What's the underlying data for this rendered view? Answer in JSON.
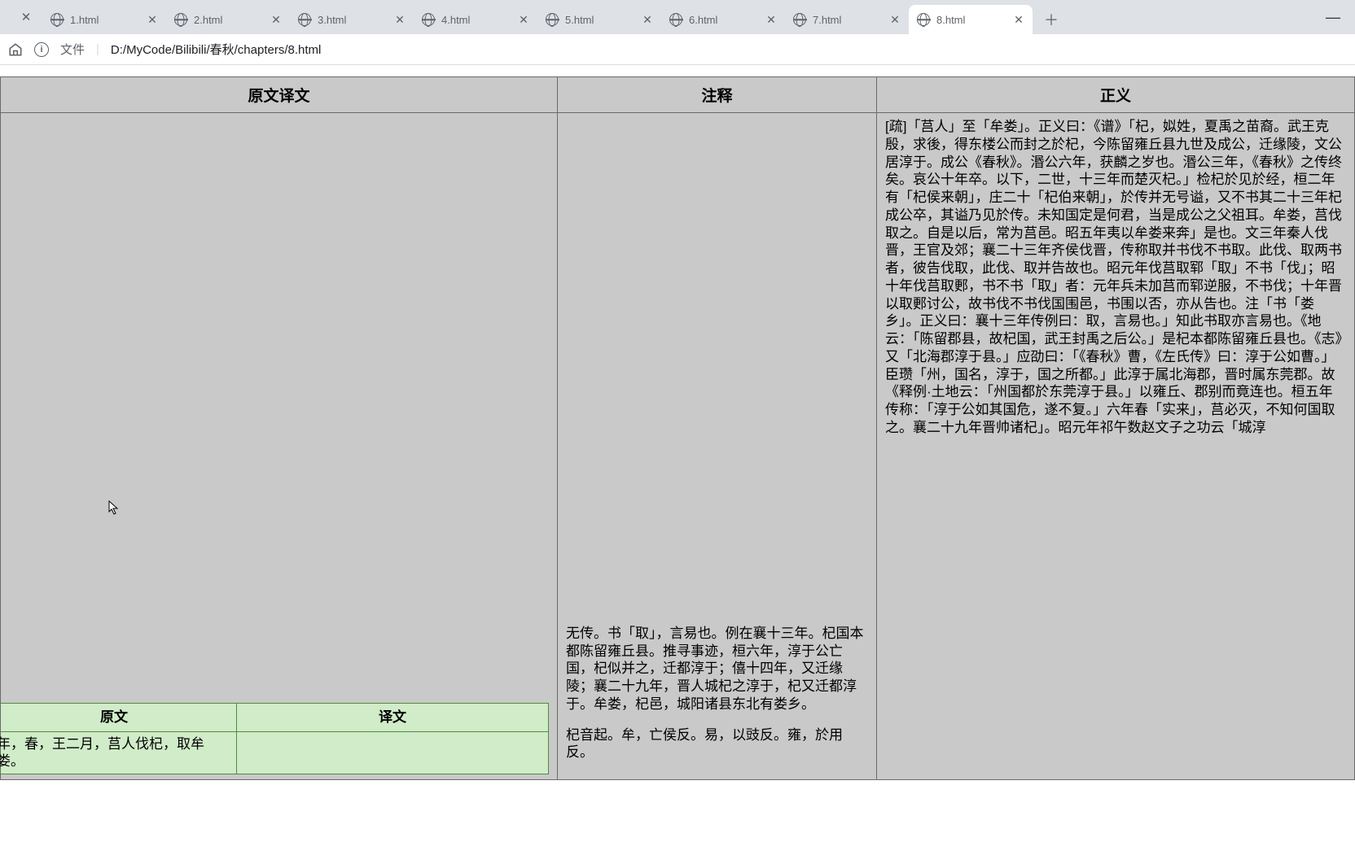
{
  "tabs": [
    {
      "label": "1.html"
    },
    {
      "label": "2.html"
    },
    {
      "label": "3.html"
    },
    {
      "label": "4.html"
    },
    {
      "label": "5.html"
    },
    {
      "label": "6.html"
    },
    {
      "label": "7.html"
    },
    {
      "label": "8.html"
    }
  ],
  "activeTabIndex": 7,
  "addressBar": {
    "fileLabel": "文件",
    "path": "D:/MyCode/Bilibili/春秋/chapters/8.html"
  },
  "headers": {
    "col1": "原文译文",
    "col2": "注释",
    "col3": "正义"
  },
  "innerHeaders": {
    "yuanwen": "原文",
    "yiwen": "译文"
  },
  "innerRow": {
    "yuanwen": "年，春，王二月，莒人伐杞，取牟娄。",
    "yiwen": ""
  },
  "col2": {
    "p1": "无传。书「取」，言易也。例在襄十三年。杞国本都陈留雍丘县。推寻事迹，桓六年，淳于公亡国，杞似并之，迁都淳于；僖十四年，又迁缘陵；襄二十九年，晋人城杞之淳于，杞又迁都淳于。牟娄，杞邑，城阳诸县东北有娄乡。",
    "p2": "杞音起。牟，亡侯反。易，以豉反。雍，於用反。"
  },
  "col3Text": "[疏]「莒人」至「牟娄」。正义曰：《谱》「杞，姒姓，夏禹之苗裔。武王克殷，求後，得东楼公而封之於杞，今陈留雍丘县九世及成公，迁缘陵，文公居淳于。成公《春秋》。湣公六年，获麟之岁也。湣公三年，《春秋》之传终矣。哀公十年卒。以下，二世，十三年而楚灭杞。」检杞於见於经，桓二年有「杞侯来朝」，庄二十「杞伯来朝」，於传并无号谥，又不书其二十三年杞成公卒，其谥乃见於传。未知国定是何君，当是成公之父祖耳。牟娄，莒伐取之。自是以后，常为莒邑。昭五年夷以牟娄来奔」是也。文三年秦人伐晋，王官及郊；襄二十三年齐侯伐晋，传称取并书伐不书取。此伐、取两书者，彼告伐取，此伐、取并告故也。昭元年伐莒取郓「取」不书「伐」；昭十年伐莒取郠，书不书「取」者：元年兵未加莒而郓逆服，不书伐；十年晋以取郠讨公，故书伐不书伐国围邑，书围以否，亦从告也。注「书「娄乡」。正义曰：襄十三年传例曰：取，言易也。」知此书取亦言易也。《地云：「陈留郡县，故杞国，武王封禹之后公。」是杞本都陈留雍丘县也。《志》又「北海郡淳于县。」应劭曰：「《春秋》曹，《左氏传》曰：淳于公如曹。」臣瓒「州，国名，淳于，国之所都。」此淳于属北海郡，晋时属东莞郡。故《释例·土地云：「州国都於东莞淳于县。」以雍丘、郡别而竟连也。桓五年传称：「淳于公如其国危，遂不复。」六年春「实来」，莒必灭，不知何国取之。襄二十九年晋帅诸杞」。昭元年祁午数赵文子之功云「城淳"
}
